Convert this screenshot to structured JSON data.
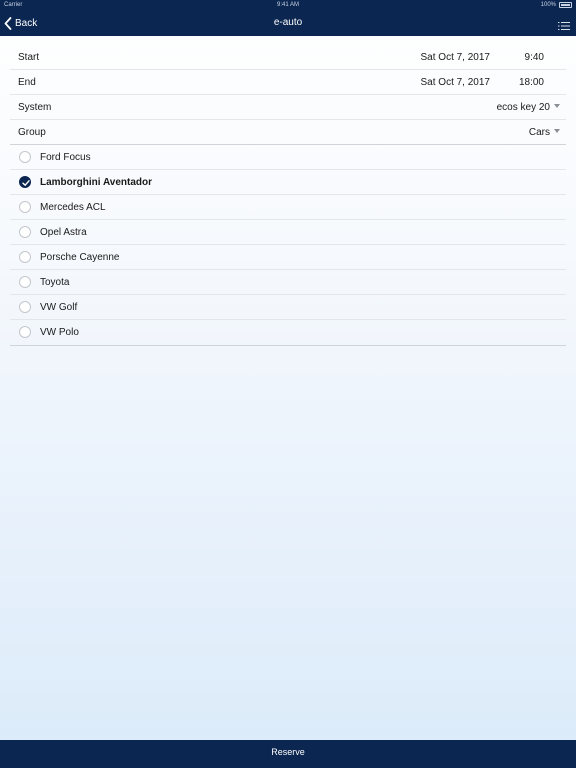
{
  "status_bar": {
    "carrier": "Carrier",
    "time": "9:41 AM",
    "battery": "100%"
  },
  "nav": {
    "back_label": "Back",
    "title": "e-auto",
    "menu_icon": "list-icon"
  },
  "form": {
    "start": {
      "label": "Start",
      "date": "Sat Oct 7, 2017",
      "time": "9:40"
    },
    "end": {
      "label": "End",
      "date": "Sat Oct 7, 2017",
      "time": "18:00"
    },
    "system": {
      "label": "System",
      "value": "ecos key 20"
    },
    "group": {
      "label": "Group",
      "value": "Cars"
    }
  },
  "cars": [
    {
      "name": "Ford Focus",
      "selected": false
    },
    {
      "name": "Lamborghini Aventador",
      "selected": true
    },
    {
      "name": "Mercedes ACL",
      "selected": false
    },
    {
      "name": "Opel Astra",
      "selected": false
    },
    {
      "name": "Porsche Cayenne",
      "selected": false
    },
    {
      "name": "Toyota",
      "selected": false
    },
    {
      "name": "VW Golf",
      "selected": false
    },
    {
      "name": "VW Polo",
      "selected": false
    }
  ],
  "footer": {
    "reserve_label": "Reserve"
  },
  "colors": {
    "bar_background": "#0b2650",
    "checked_radio": "#0b2650",
    "divider": "#e3e6ea"
  }
}
